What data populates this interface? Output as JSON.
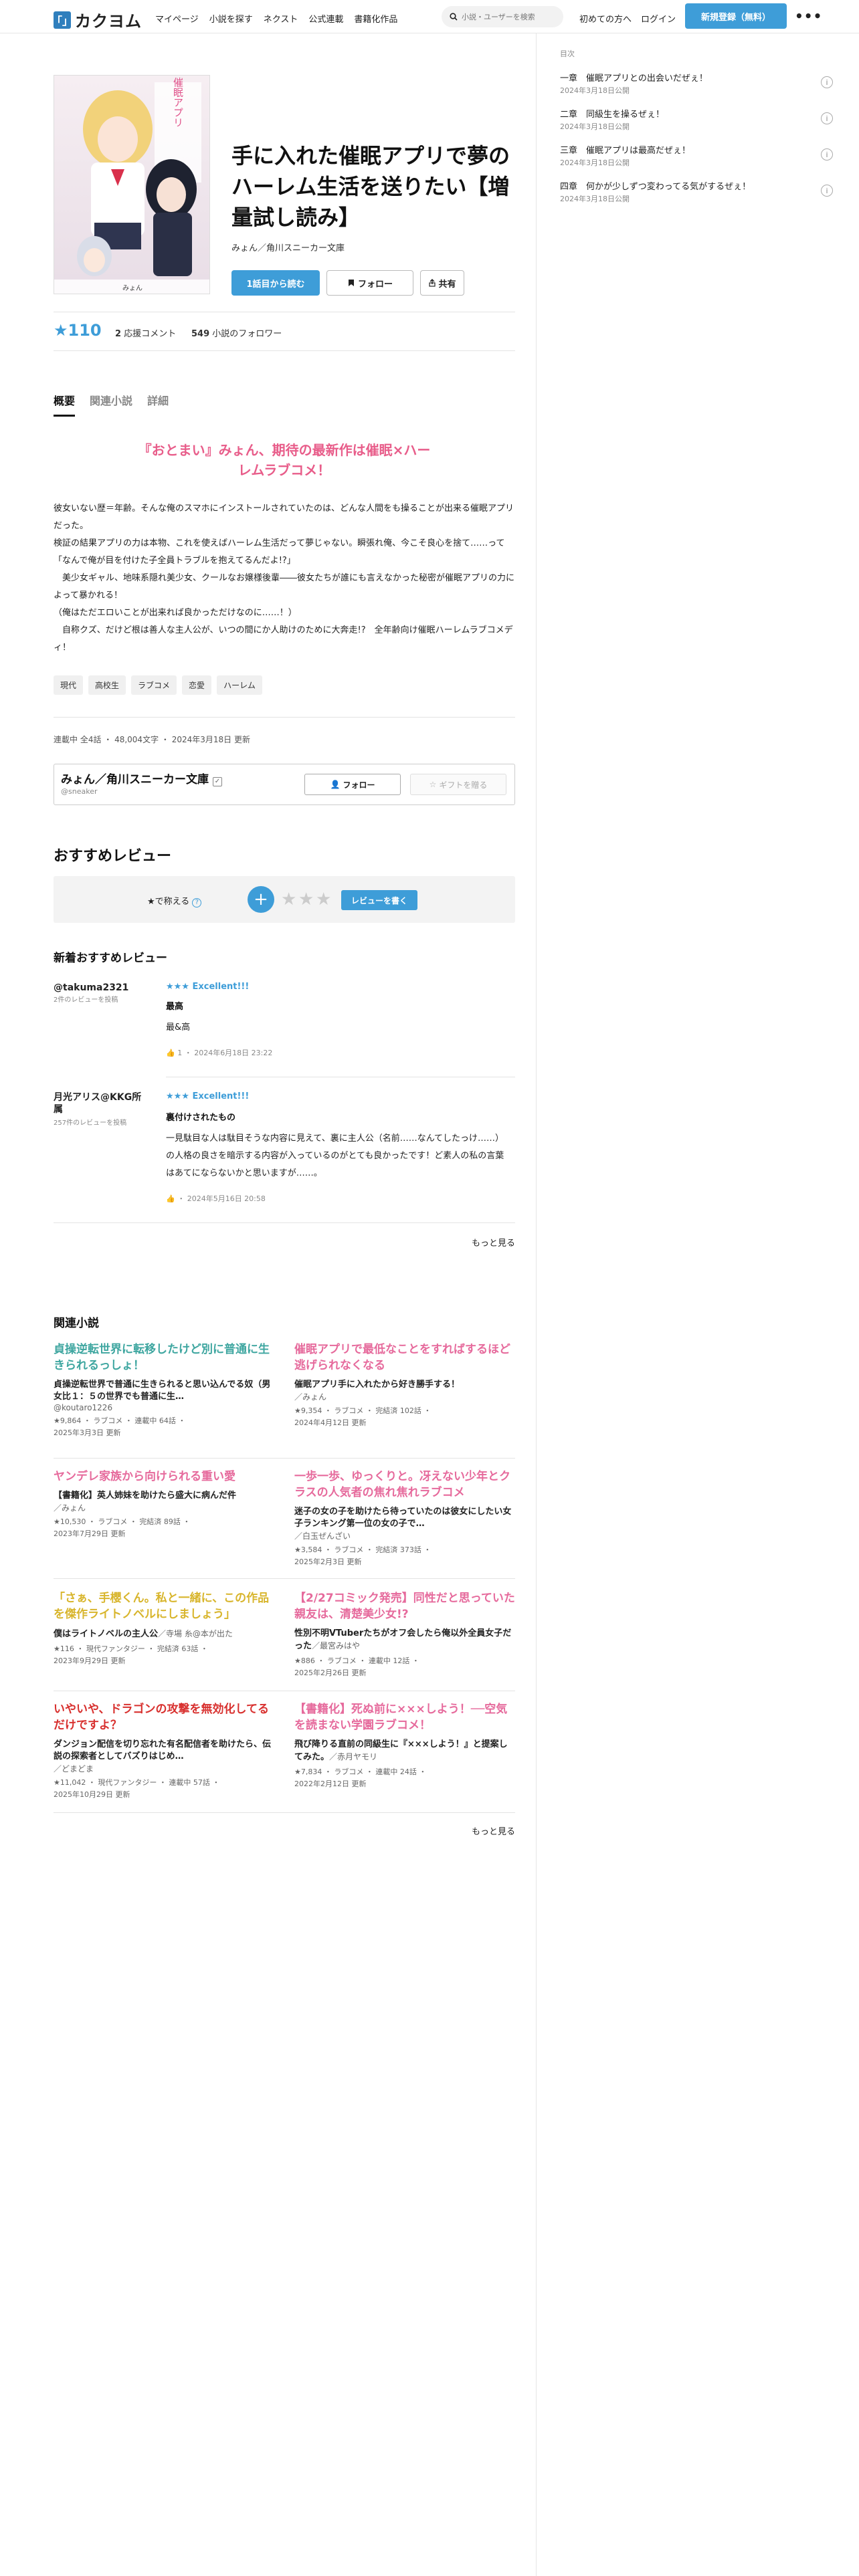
{
  "header": {
    "logo_mark": "「」",
    "logo_text": "カクヨム",
    "nav": [
      "マイページ",
      "小説を探す",
      "ネクスト",
      "公式連載",
      "書籍化作品"
    ],
    "search_placeholder": "小説・ユーザーを検索",
    "link_first": "初めての方へ",
    "link_login": "ログイン",
    "signup_label": "新規登録（無料）",
    "more_label": "•••"
  },
  "work": {
    "title": "手に入れた催眠アプリで夢のハーレム生活を送りたい【増量試し読み】",
    "author": "みょん／角川スニーカー文庫",
    "read_button": "1話目から読む",
    "follow_button": "フォロー",
    "share_button": "共有",
    "stars": "★110",
    "comments_count": "2",
    "comments_label": "応援コメント",
    "followers_count": "549",
    "followers_label": "小説のフォロワー"
  },
  "tabs": [
    "概要",
    "関連小説",
    "詳細"
  ],
  "catch_copy": "『おとまい』みょん、期待の最新作は催眠×ハーレムラブコメ！",
  "intro": "彼女いない歴＝年齢。そんな俺のスマホにインストールされていたのは、どんな人間をも操ることが出来る催眠アプリだった。\n検証の結果アプリの力は本物、これを使えばハーレム生活だって夢じゃない。瞬張れ俺、今こそ良心を捨て……って\n「なんで俺が目を付けた子全員トラブルを抱えてるんだよ!?」\n　美少女ギャル、地味系隠れ美少女、クールなお嬢様後輩――彼女たちが誰にも言えなかった秘密が催眠アプリの力によって暴かれる！\n（俺はただエロいことが出来れば良かっただけなのに……！）\n　自称クズ、だけど根は善人な主人公が、いつの間にか人助けのために大奔走!?　全年齢向け催眠ハーレムラブコメディ！",
  "tags": [
    "現代",
    "高校生",
    "ラブコメ",
    "恋愛",
    "ハーレム"
  ],
  "meta_line": "連載中 全4話 ・ 48,004文字 ・ 2024年3月18日 更新",
  "author_box": {
    "name": "みょん／角川スニーカー文庫",
    "id": "@sneaker",
    "follow_label": "フォロー",
    "gift_label": "ギフトを贈る"
  },
  "reviews_section": {
    "title": "おすすめレビュー",
    "rate_label": "★で称える",
    "rate_button": "レビューを書く",
    "new_title": "新着おすすめレビュー",
    "items": [
      {
        "user": "@takuma2321",
        "count": "2件のレビューを投稿",
        "stars": "★★★ Excellent!!!",
        "headline": "最高",
        "body": "最&高",
        "foot": "1 ・ 2024年6月18日 23:22"
      },
      {
        "user": "月光アリス@KKG所属",
        "count": "257件のレビューを投稿",
        "stars": "★★★ Excellent!!!",
        "headline": "裏付けされたもの",
        "body": "一見駄目な人は駄目そうな内容に見えて、裏に主人公（名前……なんてしたっけ……）の人格の良さを暗示する内容が入っているのがとても良かったです！ど素人の私の言葉はあてにならないかと思いますが……。",
        "foot": "・ 2024年5月16日 20:58"
      }
    ],
    "more": "もっと見る"
  },
  "related": {
    "title": "関連小説",
    "items": [
      {
        "title": "貞操逆転世界に転移したけど別に普通に生きられるっしょ！",
        "sub": "貞操逆転世界で普通に生きられると思い込んでる奴（男女比１：５の世界でも普通に生…",
        "author": "@koutaro1226",
        "meta": "★9,864 ・ ラブコメ ・ 連載中 64話 ・",
        "date": "2025年3月3日 更新",
        "color": "c-teal"
      },
      {
        "title": "催眠アプリで最低なことをすればするほど逃げられなくなる",
        "sub": "催眠アプリ手に入れたから好き勝手する！",
        "author": "／みょん",
        "meta": "★9,354 ・ ラブコメ ・ 完結済 102話 ・",
        "date": "2024年4月12日 更新",
        "color": "c-pink"
      },
      {
        "title": "ヤンデレ家族から向けられる重い愛",
        "sub": "【書籍化】英人姉妹を助けたら盛大に病んだ件",
        "author": "／みょん",
        "meta": "★10,530 ・ ラブコメ ・ 完結済 89話 ・",
        "date": "2023年7月29日 更新",
        "color": "c-pink"
      },
      {
        "title": "一歩一歩、ゆっくりと。冴えない少年とクラスの人気者の焦れ焦れラブコメ",
        "sub": "迷子の女の子を助けたら待っていたのは彼女にしたい女子ランキング第一位の女の子で…",
        "author": "／白玉ぜんざい",
        "meta": "★3,584 ・ ラブコメ ・ 完結済 373話 ・",
        "date": "2025年2月3日 更新",
        "color": "c-pink"
      },
      {
        "title": "「さぁ、手櫻くん。私と一緒に、この作品を傑作ライトノベルにしましょう」",
        "sub": "僕はライトノベルの主人公",
        "author": "／寺場 糸@本が出た",
        "meta": "★116 ・ 現代ファンタジー ・ 完結済 63話 ・",
        "date": "2023年9月29日 更新",
        "color": "c-yellow"
      },
      {
        "title": "【2/27コミック発売】同性だと思っていた親友は、清楚美少女!?",
        "sub": "性別不明VTuberたちがオフ会したら俺以外全員女子だった",
        "author": "／最宮みはや",
        "meta": "★886 ・ ラブコメ ・ 連載中 12話 ・",
        "date": "2025年2月26日 更新",
        "color": "c-pink"
      },
      {
        "title": "いやいや、ドラゴンの攻撃を無効化してるだけですよ？",
        "sub": "ダンジョン配信を切り忘れた有名配信者を助けたら、伝説の探索者としてバズりはじめ…",
        "author": "／どまどま",
        "meta": "★11,042 ・ 現代ファンタジー ・ 連載中 57話 ・",
        "date": "2025年10月29日 更新",
        "color": "c-red"
      },
      {
        "title": "【書籍化】死ぬ前に×××しよう！──空気を読まない学園ラブコメ！",
        "sub": "飛び降りる直前の同級生に『×××しよう！』と提案してみた。",
        "author": "／赤月ヤモリ",
        "meta": "★7,834 ・ ラブコメ ・ 連載中 24話 ・",
        "date": "2022年2月12日 更新",
        "color": "c-pink"
      }
    ],
    "more": "もっと見る"
  },
  "toc": {
    "label": "目次",
    "items": [
      {
        "title": "一章　催眠アプリとの出会いだぜぇ！",
        "date": "2024年3月18日公開"
      },
      {
        "title": "二章　同級生を操るぜぇ！",
        "date": "2024年3月18日公開"
      },
      {
        "title": "三章　催眠アプリは最高だぜぇ！",
        "date": "2024年3月18日公開"
      },
      {
        "title": "四章　何かが少しずつ変わってる気がするぜぇ！",
        "date": "2024年3月18日公開"
      }
    ]
  },
  "colors": {
    "accent": "#3e9dd8",
    "catch": "#e85d8a",
    "teal": "#3ea6a0",
    "pink": "#e66a9c",
    "yellow": "#d8b52c",
    "red": "#d8302e"
  }
}
